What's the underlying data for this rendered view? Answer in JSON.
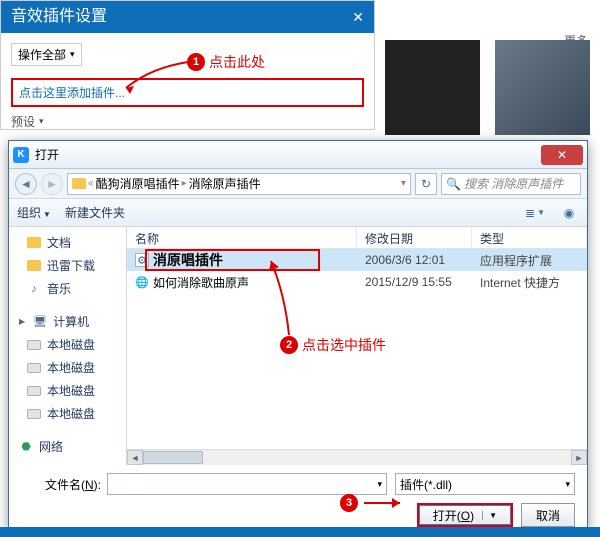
{
  "settings": {
    "title": "音效插件设置",
    "op_all": "操作全部",
    "add_plugin": "点击这里添加插件...",
    "preset": "预设"
  },
  "more": "更多",
  "anno": {
    "a1": "点击此处",
    "a2": "点击选中插件"
  },
  "dialog": {
    "title": "打开",
    "bc1": "酷狗消原唱插件",
    "bc2": "消除原声插件",
    "search_ph": "搜索 消除原声插件",
    "organize": "组织",
    "newfolder": "新建文件夹",
    "side": {
      "docs": "文档",
      "xunlei": "迅雷下载",
      "music": "音乐",
      "computer": "计算机",
      "disk": "本地磁盘",
      "network": "网络"
    },
    "cols": {
      "name": "名称",
      "date": "修改日期",
      "type": "类型"
    },
    "rows": [
      {
        "name": "消原唱插件",
        "date": "2006/3/6 12:01",
        "type": "应用程序扩展"
      },
      {
        "name": "如何消除歌曲原声",
        "date": "2015/12/9 15:55",
        "type": "Internet 快捷方"
      }
    ],
    "fname_label": "文件名(N):",
    "ftype": "插件(*.dll)",
    "open_btn": "打开(O)",
    "cancel_btn": "取消"
  }
}
